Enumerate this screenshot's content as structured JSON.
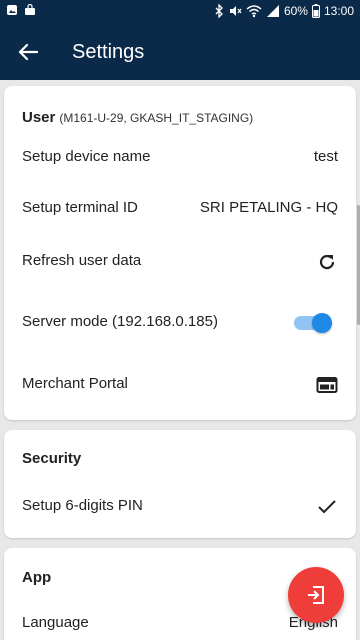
{
  "status_bar": {
    "battery": "60%",
    "time": "13:00"
  },
  "app_bar": {
    "title": "Settings"
  },
  "user_section": {
    "header": "User",
    "subheader": "(M161-U-29, GKASH_IT_STAGING)",
    "rows": [
      {
        "label": "Setup device name",
        "value": "test"
      },
      {
        "label": "Setup terminal ID",
        "value": "SRI PETALING - HQ"
      },
      {
        "label": "Refresh user data",
        "icon": "refresh-icon"
      },
      {
        "label": "Server mode (192.168.0.185)",
        "toggle_on": true
      },
      {
        "label": "Merchant Portal",
        "icon": "portal-icon"
      }
    ]
  },
  "security_section": {
    "header": "Security",
    "rows": [
      {
        "label": "Setup 6-digits PIN",
        "icon": "check-icon"
      }
    ]
  },
  "app_section": {
    "header": "App",
    "rows": [
      {
        "label": "Language",
        "value": "English"
      }
    ]
  },
  "fab": {
    "icon": "logout-icon"
  },
  "colors": {
    "primary_dark": "#0b2a4a",
    "accent": "#1e88e5",
    "fab": "#ef3d3a",
    "background": "#e8e8e8"
  }
}
